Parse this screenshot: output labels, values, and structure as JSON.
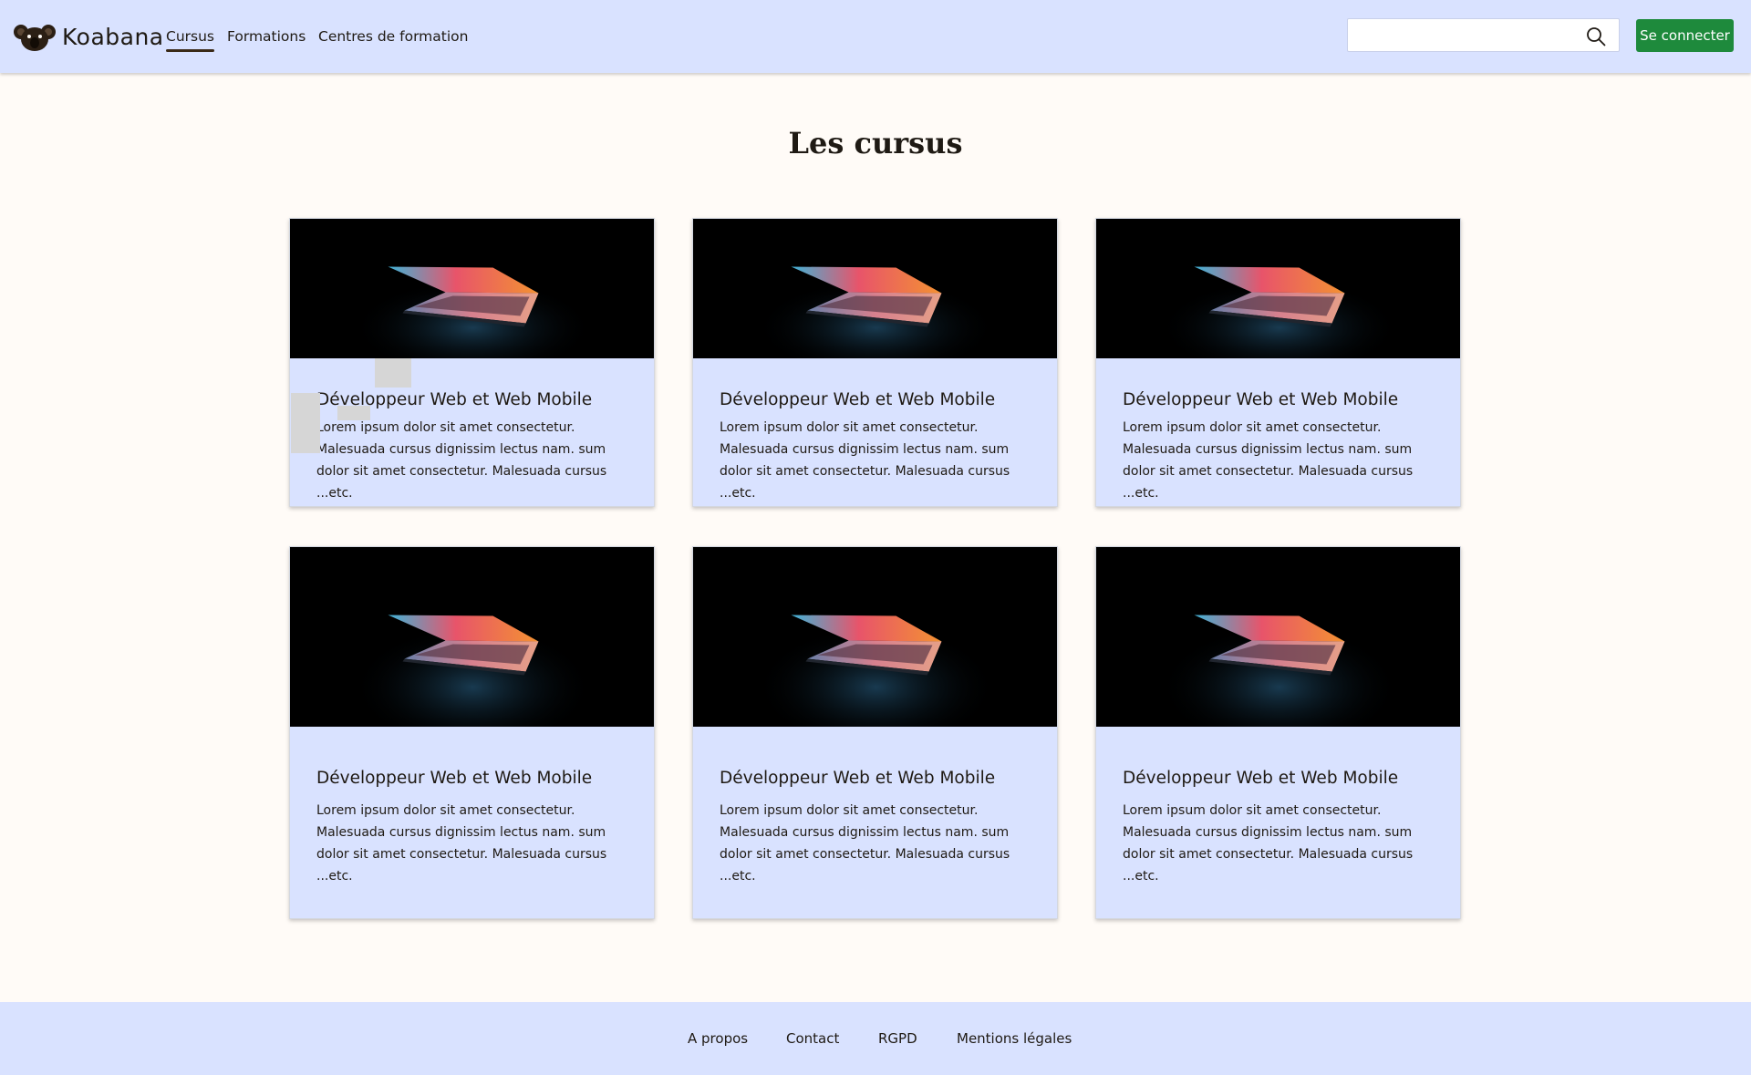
{
  "header": {
    "brand": "Koabana",
    "nav": [
      {
        "label": "Cursus",
        "active": true
      },
      {
        "label": "Formations",
        "active": false
      },
      {
        "label": "Centres de formation",
        "active": false
      }
    ],
    "search": {
      "value": "",
      "placeholder": ""
    },
    "login_label": "Se connecter"
  },
  "main": {
    "title": "Les cursus",
    "cards": [
      {
        "title": "Développeur Web et Web Mobile",
        "text": "Lorem ipsum dolor sit amet consectetur. Malesuada cursus dignissim lectus nam. sum dolor sit amet consectetur. Malesuada cursus ...etc."
      },
      {
        "title": "Développeur Web et Web Mobile",
        "text": "Lorem ipsum dolor sit amet consectetur. Malesuada cursus dignissim lectus nam. sum dolor sit amet consectetur. Malesuada cursus ...etc."
      },
      {
        "title": "Développeur Web et Web Mobile",
        "text": "Lorem ipsum dolor sit amet consectetur. Malesuada cursus dignissim lectus nam. sum dolor sit amet consectetur. Malesuada cursus ...etc."
      },
      {
        "title": "Développeur Web et Web Mobile",
        "text": "Lorem ipsum dolor sit amet consectetur. Malesuada cursus dignissim lectus nam. sum dolor sit amet consectetur. Malesuada cursus ...etc."
      },
      {
        "title": "Développeur Web et Web Mobile",
        "text": "Lorem ipsum dolor sit amet consectetur. Malesuada cursus dignissim lectus nam. sum dolor sit amet consectetur. Malesuada cursus ...etc."
      },
      {
        "title": "Développeur Web et Web Mobile",
        "text": "Lorem ipsum dolor sit amet consectetur. Malesuada cursus dignissim lectus nam. sum dolor sit amet consectetur. Malesuada cursus ...etc."
      }
    ]
  },
  "footer": {
    "links": [
      "A propos",
      "Contact",
      "RGPD",
      "Mentions légales"
    ]
  },
  "colors": {
    "header_bg": "#d9e2ff",
    "page_bg": "#fffbf7",
    "card_bg": "#d9e2ff",
    "button_green": "#1e8a3c",
    "text": "#1f1a14"
  },
  "icons": {
    "logo": "koala-logo-icon",
    "search": "search-icon",
    "card_image": "laptop-image"
  }
}
